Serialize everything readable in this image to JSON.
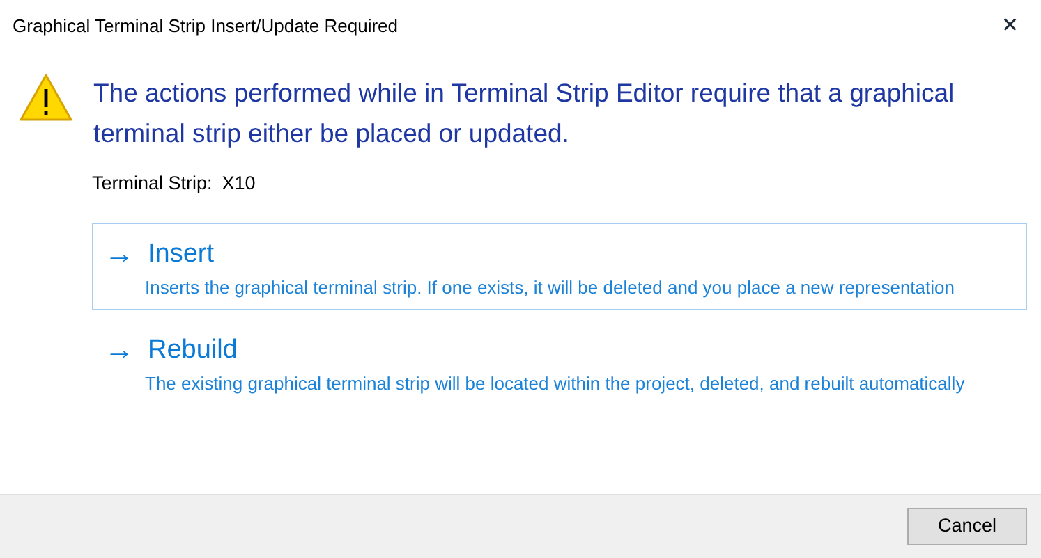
{
  "window": {
    "title": "Graphical Terminal Strip Insert/Update Required",
    "close": "✕"
  },
  "main_instruction": "The actions performed while in Terminal Strip Editor require that a graphical terminal strip either be placed or updated.",
  "terminal_strip": {
    "label": "Terminal Strip:",
    "value": "X10"
  },
  "options": [
    {
      "arrow": "→",
      "title": "Insert",
      "description": "Inserts the graphical terminal strip.  If one exists, it will be deleted and you place a new representation",
      "selected": true
    },
    {
      "arrow": "→",
      "title": "Rebuild",
      "description": "The existing graphical terminal strip will be located within the project, deleted, and rebuilt automatically",
      "selected": false
    }
  ],
  "buttons": [
    "Cancel"
  ]
}
